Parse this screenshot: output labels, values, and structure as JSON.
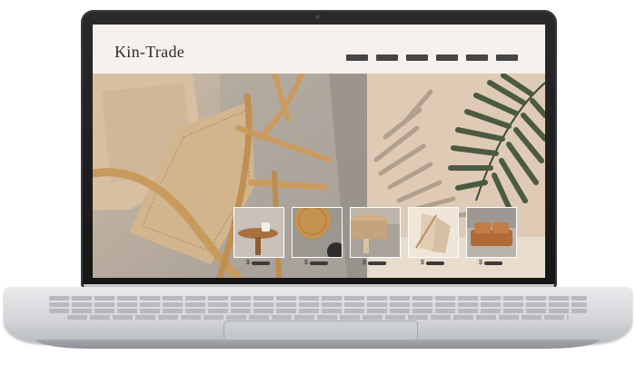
{
  "site": {
    "logo": "Kin-Trade",
    "nav_items": [
      "",
      "",
      "",
      "",
      "",
      ""
    ]
  },
  "hero": {
    "left_image": "rattan-chair-photo",
    "right_image": "palm-leaf-shadow-photo"
  },
  "products": [
    {
      "image": "side-table-with-mug",
      "currency": "$",
      "price": ""
    },
    {
      "image": "wooden-tray",
      "currency": "$",
      "price": ""
    },
    {
      "image": "woven-stool",
      "currency": "$",
      "price": ""
    },
    {
      "image": "linen-chair",
      "currency": "$",
      "price": ""
    },
    {
      "image": "cushioned-sofa",
      "currency": "$",
      "price": ""
    }
  ],
  "colors": {
    "header_bg": "#f6f1ec",
    "nav_bar": "#454545",
    "bezel": "#1b1b1c",
    "chassis": "#d4d6d9"
  }
}
